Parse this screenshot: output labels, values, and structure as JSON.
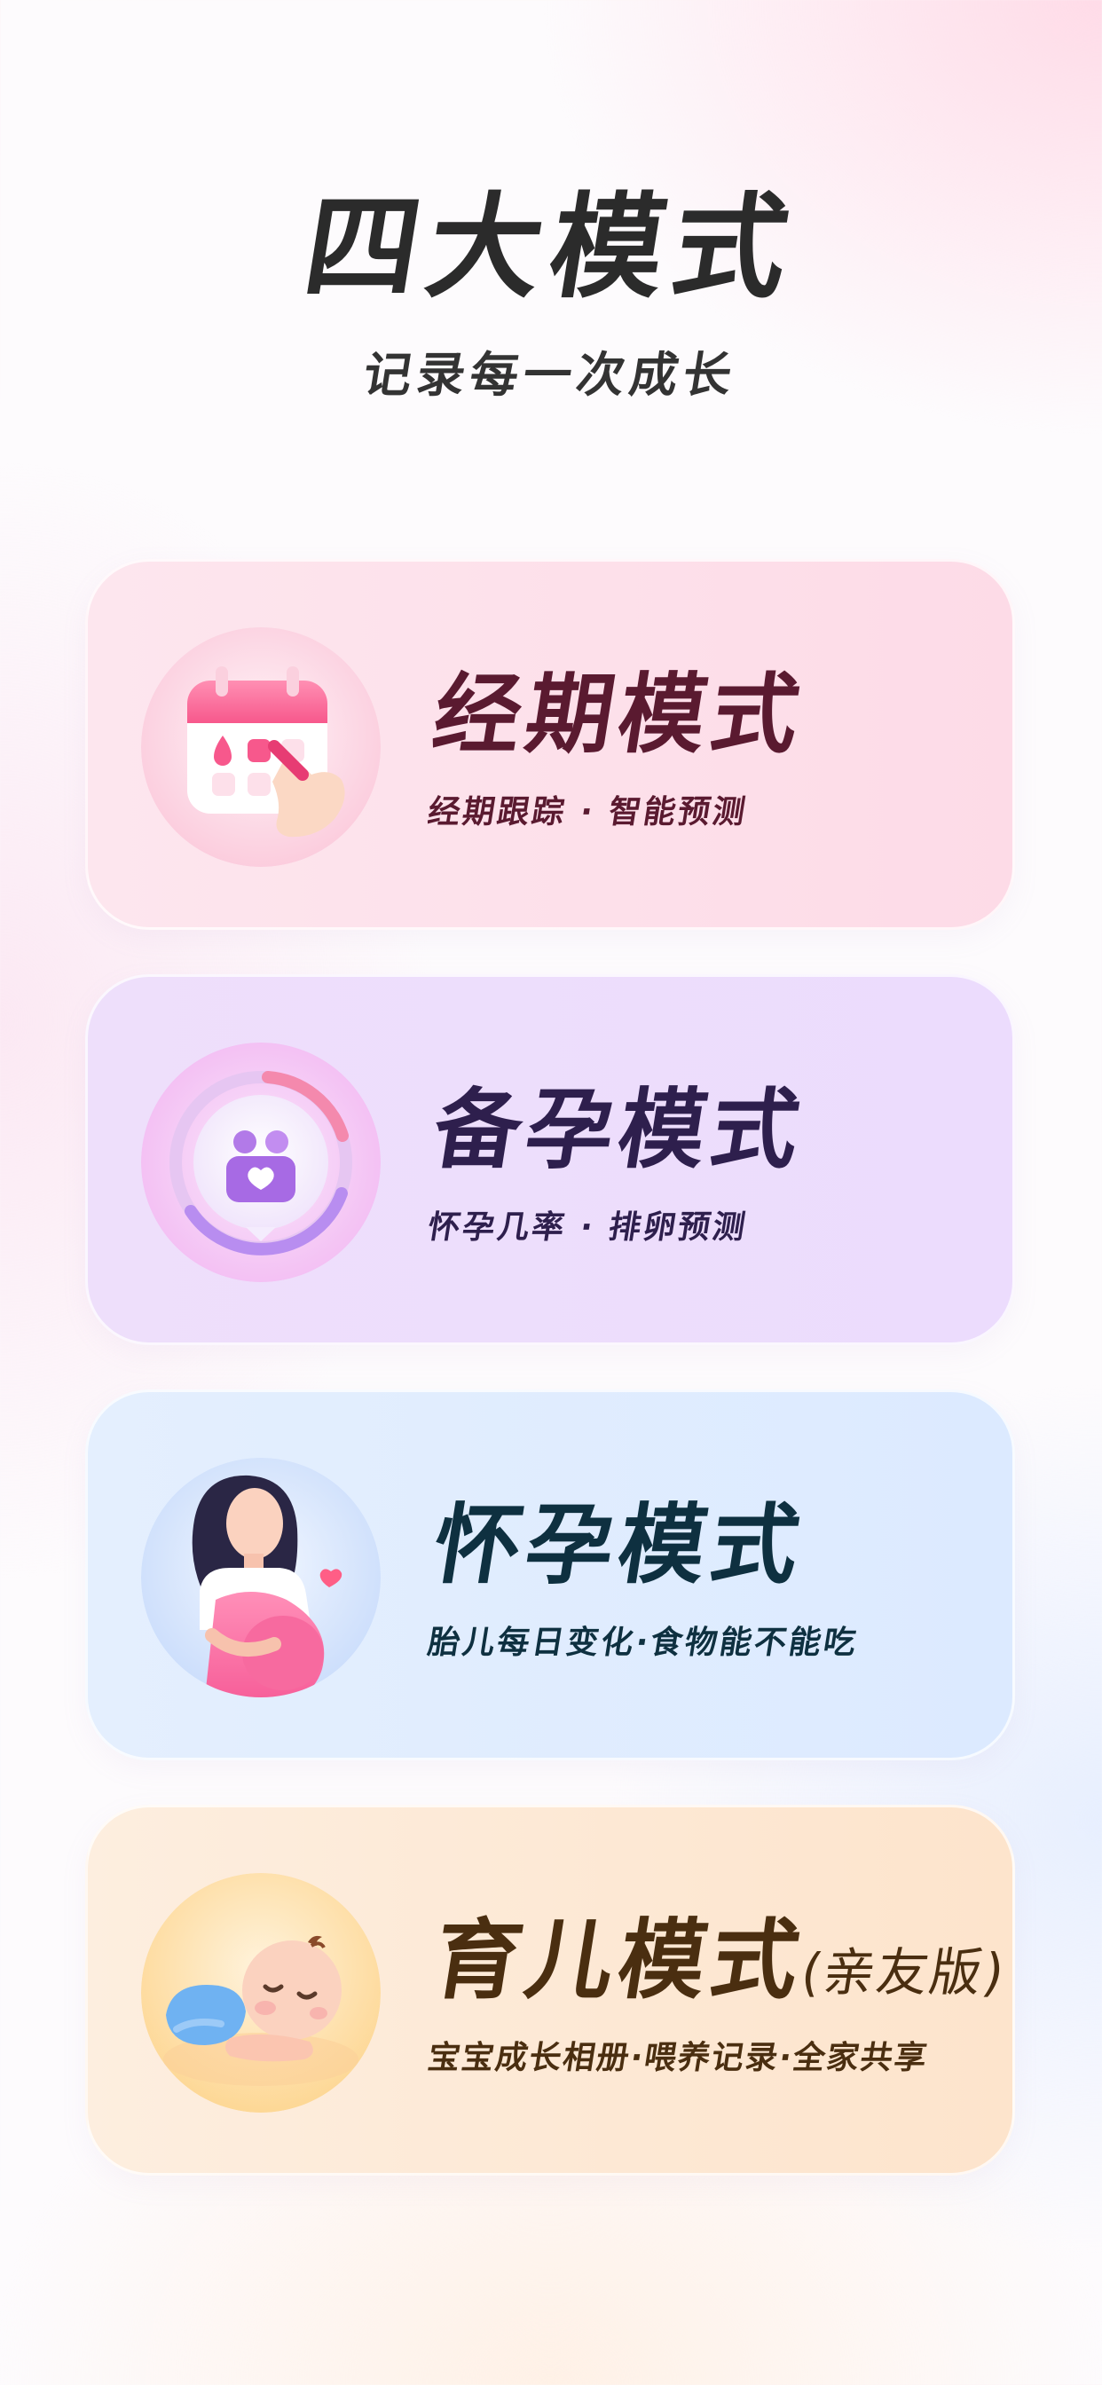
{
  "header": {
    "title": "四大模式",
    "subtitle": "记录每一次成长"
  },
  "modes": [
    {
      "title": "经期模式",
      "title_suffix": "",
      "desc": "经期跟踪 · 智能预测",
      "icon": "calendar-icon"
    },
    {
      "title": "备孕模式",
      "title_suffix": "",
      "desc": "怀孕几率 · 排卵预测",
      "icon": "ovulation-ring-icon"
    },
    {
      "title": "怀孕模式",
      "title_suffix": "",
      "desc": "胎儿每日变化·食物能不能吃",
      "icon": "pregnant-woman-icon"
    },
    {
      "title": "育儿模式",
      "title_suffix": "(亲友版)",
      "desc": "宝宝成长相册·喂养记录·全家共享",
      "icon": "sleeping-baby-icon"
    }
  ],
  "colors": {
    "period_card": "#fde2eb",
    "prep_card": "#eddcfc",
    "preg_card": "#e0ecfe",
    "baby_card": "#fde9d6"
  }
}
